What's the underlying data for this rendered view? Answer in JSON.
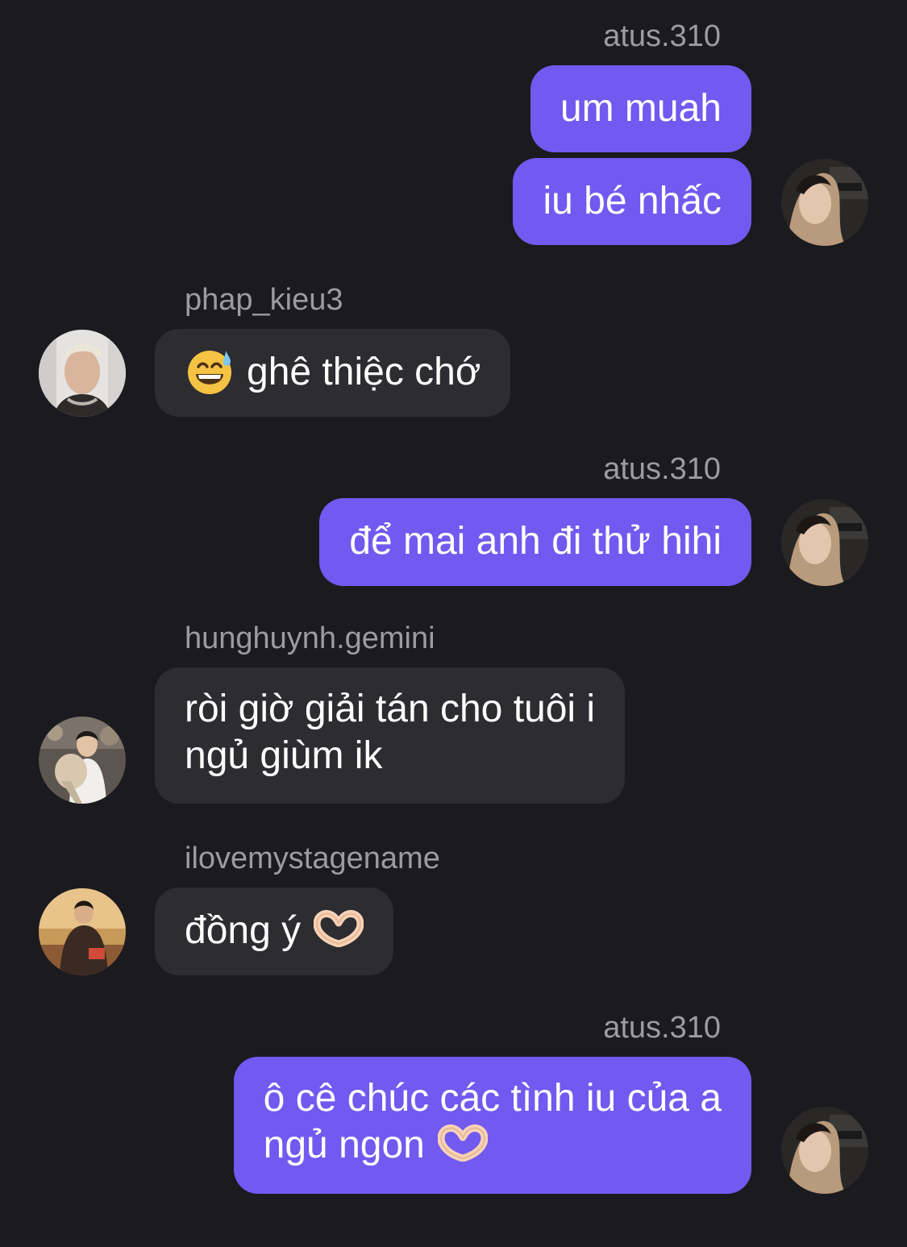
{
  "messages": [
    {
      "id": "m1",
      "sender": "atus.310",
      "lines": [
        "um muah"
      ]
    },
    {
      "id": "m2",
      "sender": "atus.310",
      "lines": [
        "iu bé nhấc"
      ]
    },
    {
      "id": "m3",
      "sender": "phap_kieu3",
      "text": "ghê thiệc chớ",
      "emoji_icon": "sweat-smile-emoji-icon"
    },
    {
      "id": "m4",
      "sender": "atus.310",
      "lines": [
        "để mai anh đi thử hihi"
      ]
    },
    {
      "id": "m5",
      "sender": "hunghuynh.gemini",
      "lines": [
        "ròi giờ giải tán cho tuôi i",
        "ngủ giùm ik"
      ]
    },
    {
      "id": "m6",
      "sender": "ilovemystagename",
      "text": "đồng ý",
      "emoji_icon": "heart-hands-emoji-icon"
    },
    {
      "id": "m7",
      "sender": "atus.310",
      "lines": [
        "ô cê chúc các tình iu của a",
        "ngủ ngon"
      ],
      "emoji_icon": "heart-hands-emoji-icon"
    }
  ],
  "colors": {
    "background": "#1b1a1f",
    "outgoing_bubble": "#7259ef",
    "incoming_bubble": "#2c2c31",
    "sender_text": "#9c9ba3"
  }
}
